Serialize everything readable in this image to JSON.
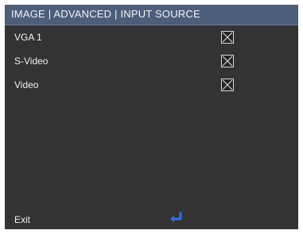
{
  "header": {
    "title": "IMAGE | ADVANCED | INPUT SOURCE"
  },
  "sources": [
    {
      "label": "VGA 1",
      "checked": true
    },
    {
      "label": "S-Video",
      "checked": true
    },
    {
      "label": "Video",
      "checked": true
    }
  ],
  "footer": {
    "exit_label": "Exit",
    "enter_icon": "enter-return-icon"
  },
  "colors": {
    "panel": "#333333",
    "header": "#4d5e7a",
    "accent_icon": "#2f6de0"
  }
}
